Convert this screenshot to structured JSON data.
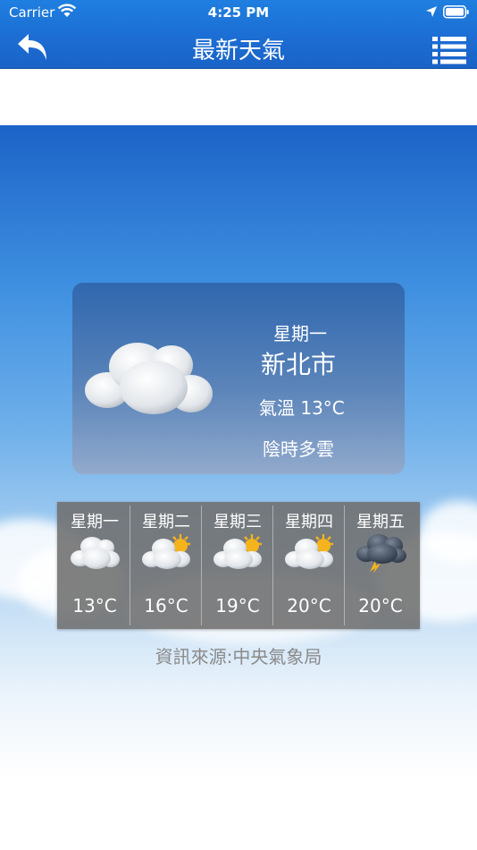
{
  "status_bar": {
    "carrier": "Carrier",
    "time": "4:25 PM"
  },
  "nav": {
    "title": "最新天氣",
    "back_icon": "back-arrow-icon",
    "menu_icon": "list-menu-icon"
  },
  "today": {
    "weekday": "星期一",
    "city": "新北市",
    "temperature": "氣溫 13°C",
    "description": "陰時多雲",
    "icon": "cloudy-icon"
  },
  "forecast": [
    {
      "day": "星期一",
      "temp": "13°C",
      "icon": "cloudy-icon"
    },
    {
      "day": "星期二",
      "temp": "16°C",
      "icon": "partly-sunny-icon"
    },
    {
      "day": "星期三",
      "temp": "19°C",
      "icon": "partly-sunny-icon"
    },
    {
      "day": "星期四",
      "temp": "20°C",
      "icon": "partly-sunny-icon"
    },
    {
      "day": "星期五",
      "temp": "20°C",
      "icon": "thunderstorm-icon"
    }
  ],
  "source": "資訊來源:中央氣象局",
  "colors": {
    "header": "#1c6cd2",
    "sun": "#f5b31c",
    "storm_cloud": "#3d4b5c"
  }
}
